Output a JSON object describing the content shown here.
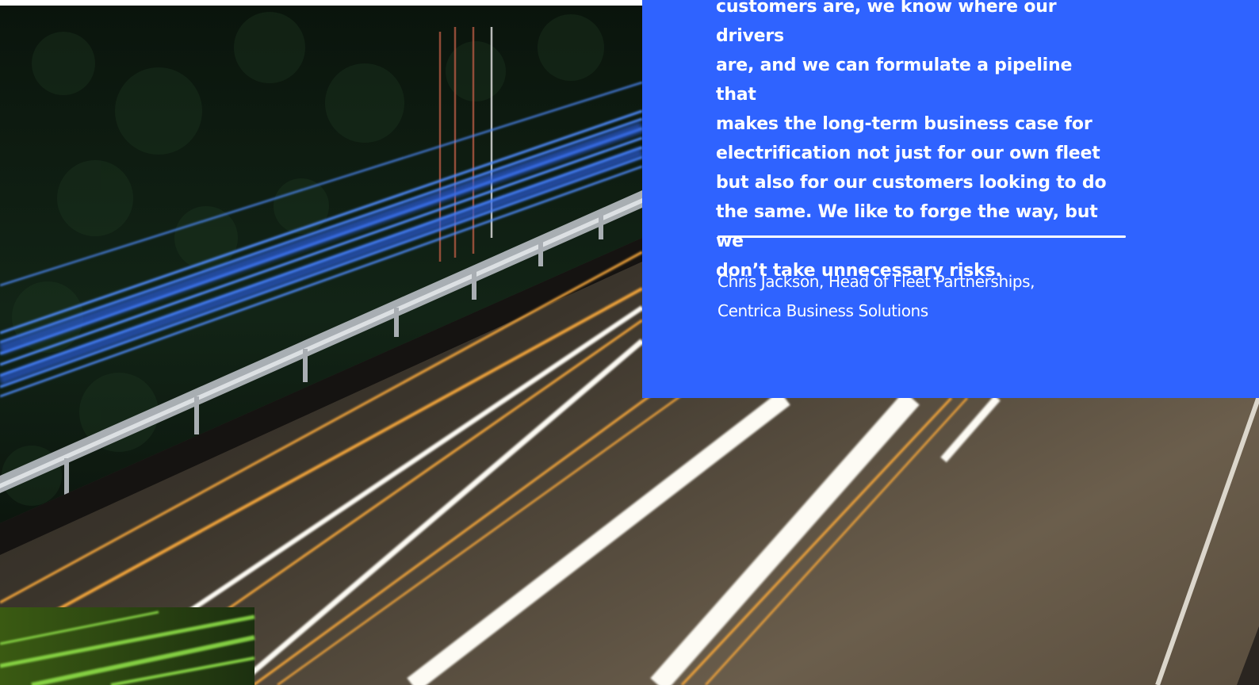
{
  "page": {
    "accent_color": "#2f63ff",
    "photo_subject": "night-highway-light-trails"
  },
  "quote": {
    "text": "customers are, we know where our drivers\nare, and we can formulate a pipeline that\nmakes the long-term business case for\nelectrification not just for our own fleet\nbut also for our customers looking to do\nthe same. We like to forge the way, but we\ndon’t take unnecessary risks.",
    "attribution": "Chris Jackson, Head of Fleet Partnerships,\nCentrica Business Solutions"
  }
}
